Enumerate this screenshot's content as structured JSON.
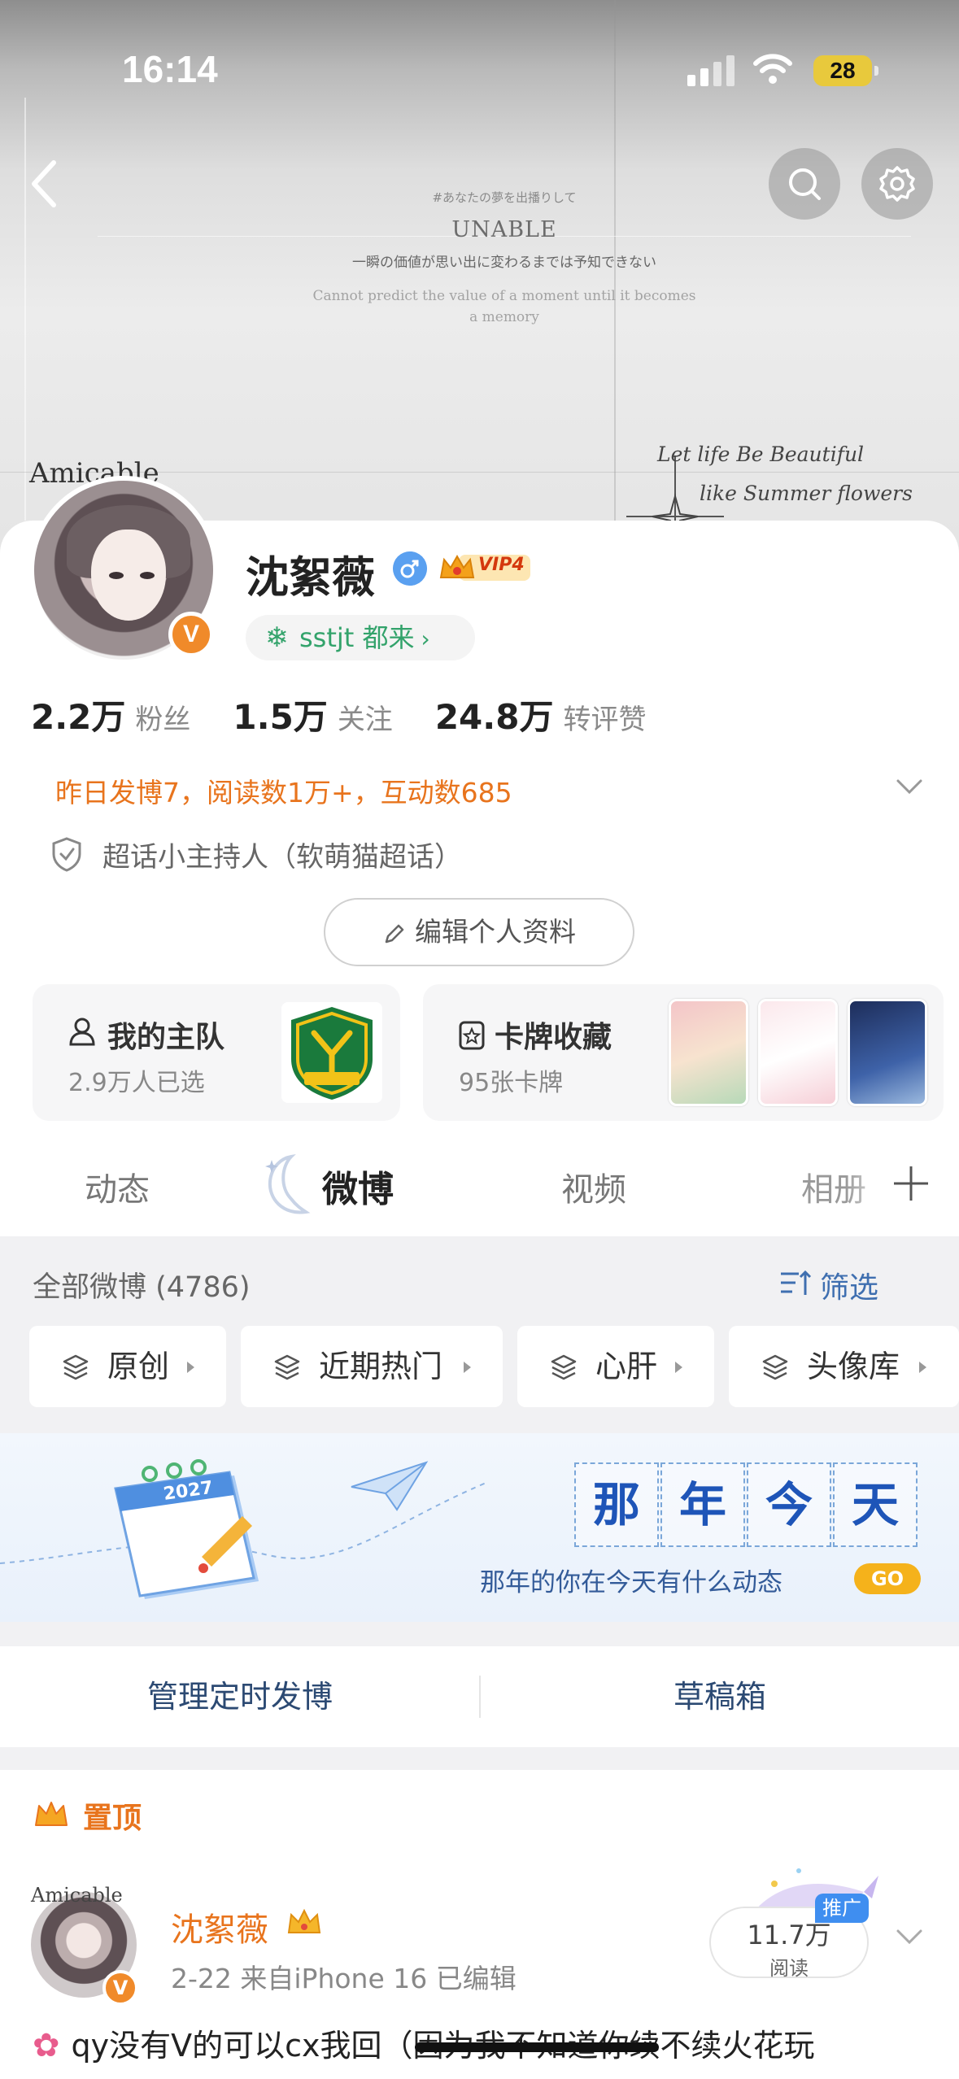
{
  "status_bar": {
    "time": "16:14",
    "battery": "28"
  },
  "header_art": {
    "poem_line1": "#あなたの夢を出播りして",
    "poem_line2": "UNABLE",
    "poem_line3": "一瞬の価値が思い出に変わるまでは予知できない",
    "poem_line4": "Cannot predict the value of a moment until it becomes a memory",
    "handwriting": [
      "Let life Be Beautiful",
      "like Summer flowers",
      "life"
    ],
    "avatar_overlay_text": "Amicable"
  },
  "profile": {
    "name": "沈絮薇",
    "vip_label": "VIP4",
    "verified_badge": "V",
    "tag": "sstjt 都来",
    "stats": [
      {
        "value": "2.2万",
        "label": "粉丝"
      },
      {
        "value": "1.5万",
        "label": "关注"
      },
      {
        "value": "24.8万",
        "label": "转评赞"
      }
    ],
    "summary": "昨日发博7，阅读数1万+，互动数685",
    "host": "超话小主持人（软萌猫超话）",
    "edit_label": "编辑个人资料"
  },
  "team_card": {
    "title": "我的主队",
    "subtitle": "2.9万人已选"
  },
  "card_collection": {
    "title": "卡牌收藏",
    "subtitle": "95张卡牌"
  },
  "tabs": [
    "动态",
    "微博",
    "视频",
    "相册"
  ],
  "active_tab": "微博",
  "feed": {
    "count_label": "全部微博 (4786)",
    "filter_label": "筛选",
    "chips": [
      "原创",
      "近期热门",
      "心肝",
      "头像库"
    ]
  },
  "banner": {
    "title_chars": [
      "那",
      "年",
      "今",
      "天"
    ],
    "subtitle": "那年的你在今天有什么动态",
    "go_label": "GO",
    "calendar_year": "2027"
  },
  "actions": {
    "scheduled": "管理定时发博",
    "drafts": "草稿箱"
  },
  "post": {
    "pinned_label": "置顶",
    "author": "沈絮薇",
    "meta": "2-22  来自iPhone 16  已编辑",
    "promo_label": "推广",
    "reads_value": "11.7万",
    "reads_label": "阅读",
    "body": "qy没有V的可以cx我回（因为我不知道你续不续火花玩"
  },
  "colors": {
    "accent": "#e8741d",
    "link": "#3f6fb0",
    "green": "#33a36b",
    "vbadge": "#f08a2a"
  }
}
